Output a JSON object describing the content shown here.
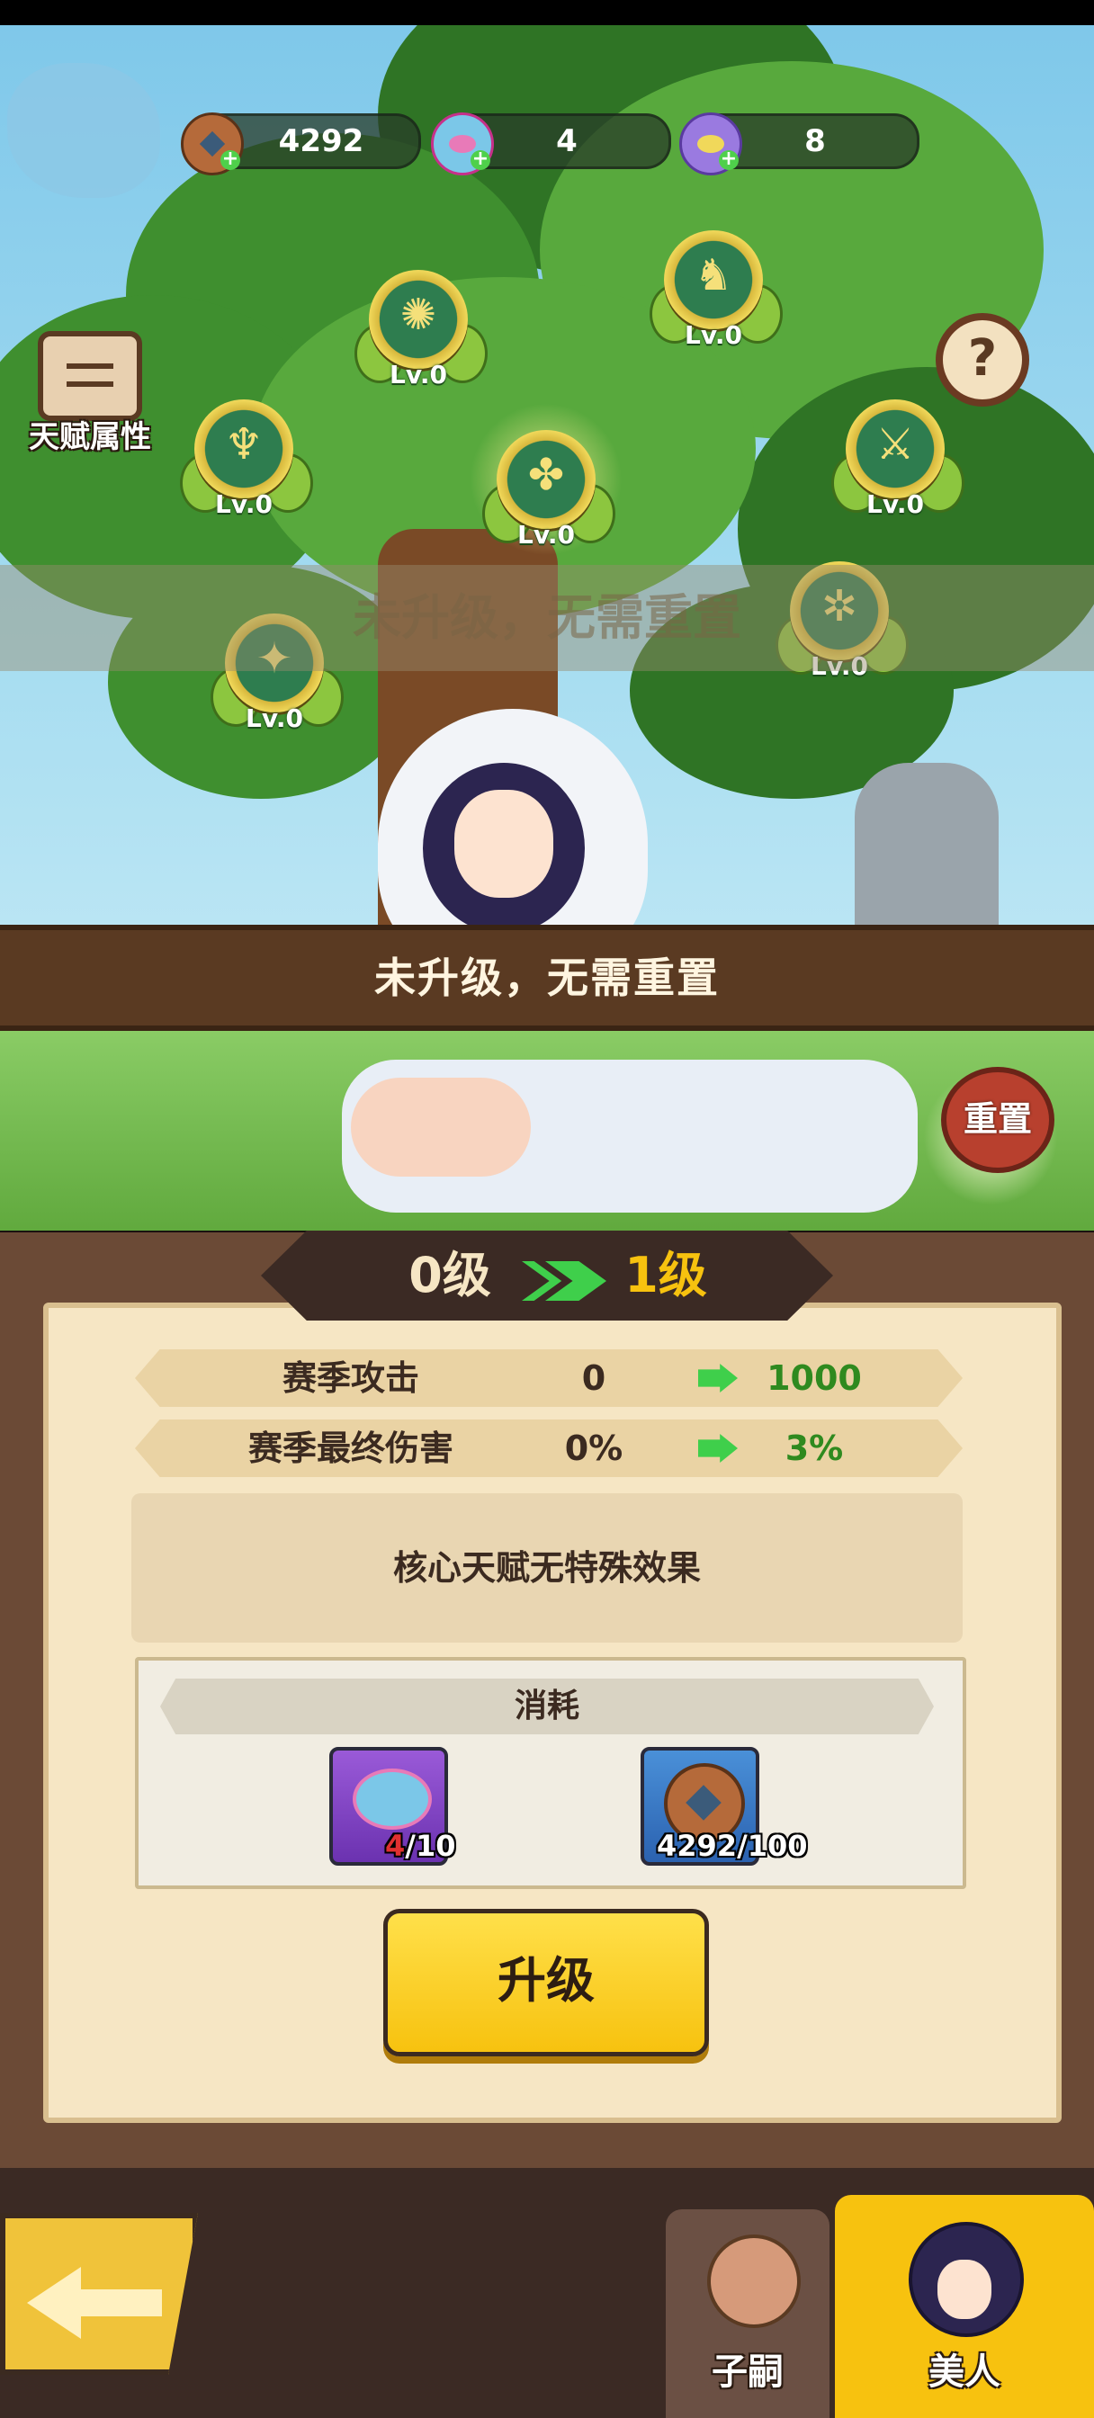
{
  "resources": [
    {
      "icon": "copper-coin-icon",
      "value": "4292"
    },
    {
      "icon": "butterfly-ornament-icon",
      "value": "4"
    },
    {
      "icon": "purple-butterfly-icon",
      "value": "8"
    }
  ],
  "talent_attr_label": "天赋属性",
  "help_icon_glyph": "?",
  "talent_nodes": [
    {
      "name": "talent-node-top-left",
      "level": "Lv.0"
    },
    {
      "name": "talent-node-horse",
      "level": "Lv.0"
    },
    {
      "name": "talent-node-trident",
      "level": "Lv.0"
    },
    {
      "name": "talent-node-core",
      "level": "Lv.0"
    },
    {
      "name": "talent-node-swords",
      "level": "Lv.0"
    },
    {
      "name": "talent-node-fan",
      "level": "Lv.0"
    },
    {
      "name": "talent-node-spear",
      "level": "Lv.0"
    }
  ],
  "ghost_message": "未升级，无需重置",
  "message": "未升级，无需重置",
  "reset_label": "重置",
  "level": {
    "current": "0级",
    "next": "1级"
  },
  "stats": [
    {
      "name": "赛季攻击",
      "current": "0",
      "next": "1000"
    },
    {
      "name": "赛季最终伤害",
      "current": "0%",
      "next": "3%"
    }
  ],
  "effect_text": "核心天赋无特殊效果",
  "cost_title": "消耗",
  "costs": [
    {
      "icon": "butterfly-ornament-icon",
      "owned": "4",
      "required": "/10"
    },
    {
      "icon": "copper-coin-icon",
      "owned": "4292",
      "required": "/100"
    }
  ],
  "upgrade_label": "升级",
  "nav": {
    "heir_label": "子嗣",
    "beauty_label": "美人"
  },
  "colors": {
    "accent_yellow": "#f7c20f",
    "next_value_green": "#2f8a1f",
    "insufficient_red": "#e03030",
    "panel_bg": "#f6e6c4"
  }
}
